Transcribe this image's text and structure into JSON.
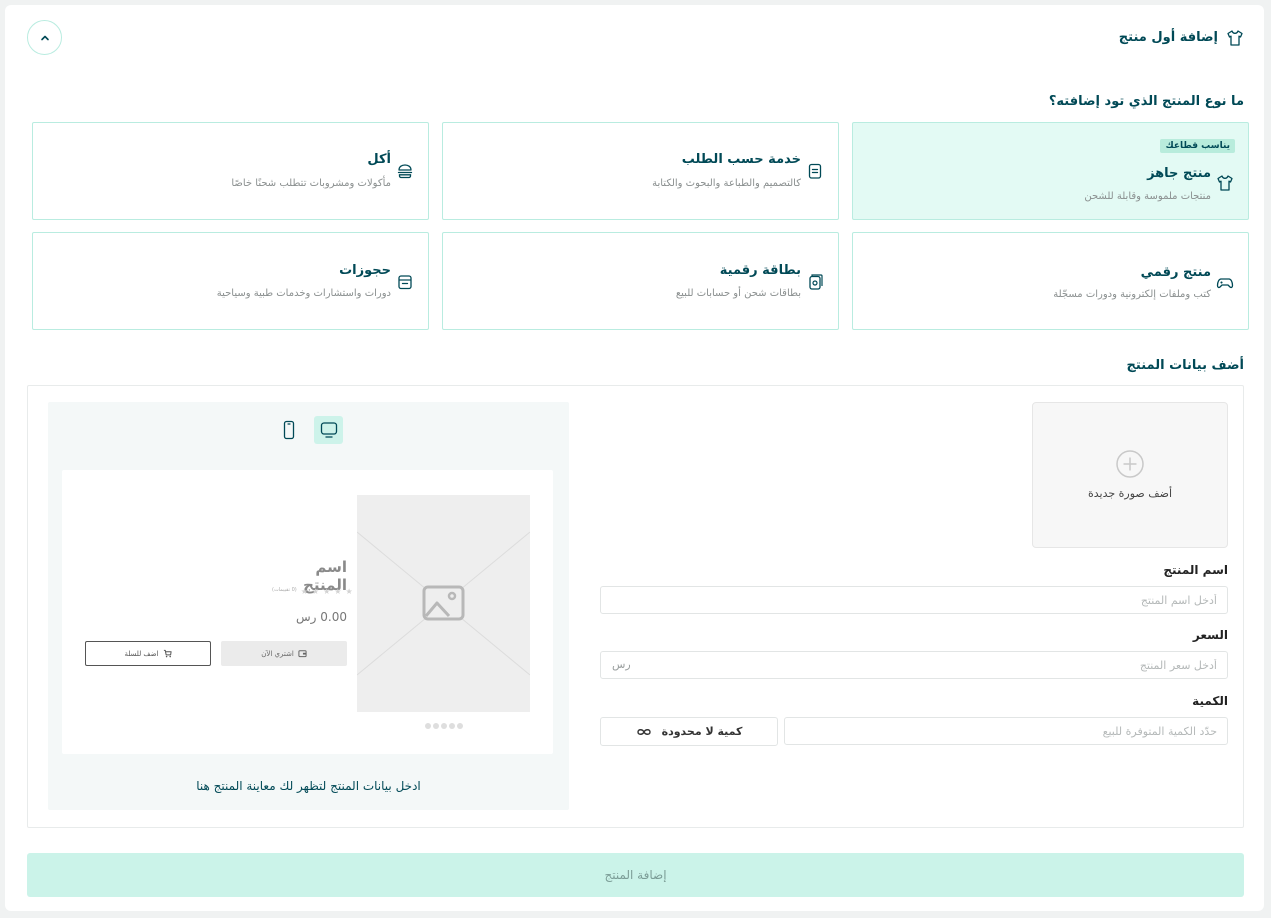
{
  "header": {
    "title": "إضافة أول منتج"
  },
  "type_section": {
    "title": "ما نوع المنتج الذي تود إضافته؟",
    "badge": "يناسب قطاعك",
    "cards": [
      {
        "title": "منتج جاهز",
        "desc": "منتجات ملموسة وقابلة للشحن",
        "icon": "tshirt-icon",
        "selected": true
      },
      {
        "title": "خدمة حسب الطلب",
        "desc": "كالتصميم والطباعة والبحوث والكتابة",
        "icon": "clipboard-icon",
        "selected": false
      },
      {
        "title": "أكل",
        "desc": "مأكولات ومشروبات تتطلب شحنًا خاصًا",
        "icon": "burger-icon",
        "selected": false
      },
      {
        "title": "منتج رقمي",
        "desc": "كتب وملفات إلكترونية ودورات مسجّلة",
        "icon": "gamepad-icon",
        "selected": false
      },
      {
        "title": "بطاقة رقمية",
        "desc": "بطاقات شحن أو حسابات للبيع",
        "icon": "gift-card-icon",
        "selected": false
      },
      {
        "title": "حجوزات",
        "desc": "دورات واستشارات وخدمات طبية وسياحية",
        "icon": "calendar-icon",
        "selected": false
      }
    ]
  },
  "data_section": {
    "title": "أضف بيانات المنتج",
    "upload_label": "أضف صورة جديدة",
    "name_label": "اسم المنتج",
    "name_placeholder": "أدخل اسم المنتج",
    "name_value": "",
    "price_label": "السعر",
    "price_placeholder": "أدخل سعر المنتج",
    "price_value": "",
    "currency": "رس",
    "qty_label": "الكمية",
    "qty_placeholder": "حدّد الكمية المتوفرة للبيع",
    "qty_value": "",
    "unlimited_label": "كمية لا محدودة"
  },
  "preview": {
    "product_name": "اسم المنتج",
    "rating_text": "(0 تقييمات)",
    "price": "0.00 رس",
    "buy_now": "اشتري الآن",
    "add_to_cart": "اضف للسلة",
    "hint": "ادخل بيانات المنتج لتظهر لك معاينة المنتج هنا"
  },
  "submit_label": "إضافة المنتج",
  "colors": {
    "primary": "#004956",
    "accent_light": "#cbf3e9",
    "selected_bg": "#e3faf4",
    "border": "#b9ece0"
  }
}
